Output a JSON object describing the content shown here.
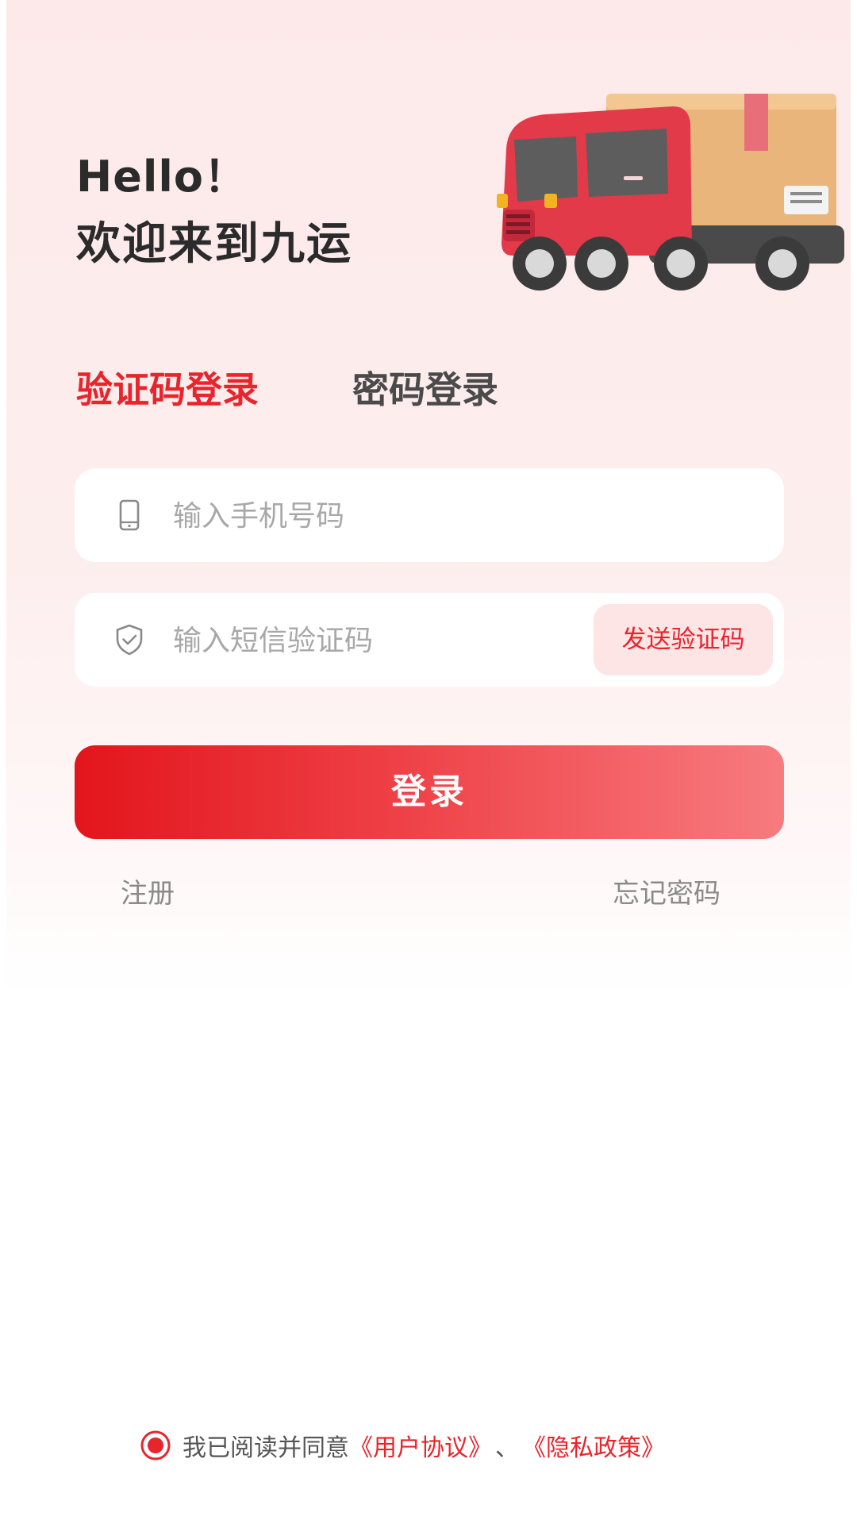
{
  "greeting": {
    "hello": "Hello！",
    "welcome": "欢迎来到九运"
  },
  "tabs": [
    {
      "label": "验证码登录",
      "active": true
    },
    {
      "label": "密码登录",
      "active": false
    }
  ],
  "form": {
    "phone_placeholder": "输入手机号码",
    "phone_value": "",
    "code_placeholder": "输入短信验证码",
    "code_value": "",
    "send_code_label": "发送验证码"
  },
  "login_label": "登录",
  "links": {
    "register": "注册",
    "forgot_password": "忘记密码"
  },
  "agreement": {
    "checked": true,
    "text": "我已阅读并同意",
    "user_agreement": "《用户协议》",
    "separator": "、",
    "privacy_policy": "《隐私政策》"
  },
  "icons": {
    "phone": "phone-icon",
    "shield": "shield-check-icon",
    "truck": "delivery-truck-illustration",
    "radio": "radio-checked-icon"
  },
  "colors": {
    "accent": "#e8242c",
    "button_start": "#e3151c",
    "button_end": "#f77b7f",
    "send_code_bg": "#fde4e5",
    "background_top": "#fde9e9"
  }
}
